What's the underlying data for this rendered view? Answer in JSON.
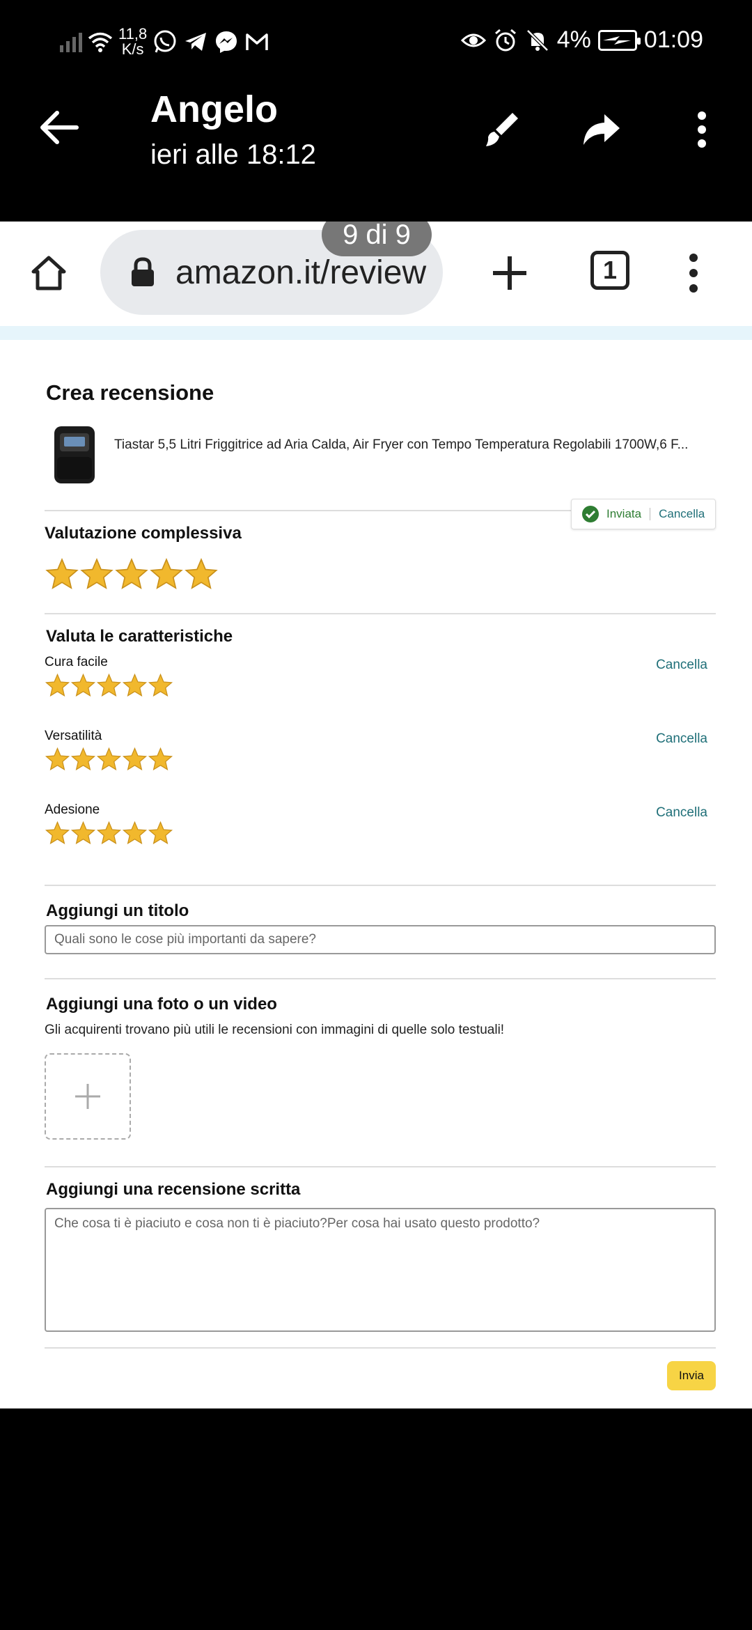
{
  "status_bar": {
    "speed_top": "11,8",
    "speed_bottom": "K/s",
    "battery": "4%",
    "time": "01:09"
  },
  "viewer": {
    "sender": "Angelo",
    "timestamp": "ieri alle 18:12",
    "icons": [
      "back-arrow-icon",
      "brush-icon",
      "forward-icon",
      "more-vert-icon"
    ]
  },
  "browser": {
    "url": "amazon.it/review",
    "tab_count": "1",
    "page_counter": "9 di 9"
  },
  "review": {
    "heading": "Crea recensione",
    "product_title": "Tiastar 5,5 Litri Friggitrice ad Aria Calda, Air Fryer con Tempo Temperatura Regolabili 1700W,6 F...",
    "overall": {
      "label": "Valutazione complessiva",
      "rating": 5,
      "max": 5,
      "status_sent": "Inviata",
      "cancel": "Cancella"
    },
    "features": {
      "label": "Valuta le caratteristiche",
      "items": [
        {
          "name": "Cura facile",
          "rating": 5,
          "cancel": "Cancella"
        },
        {
          "name": "Versatilità",
          "rating": 5,
          "cancel": "Cancella"
        },
        {
          "name": "Adesione",
          "rating": 5,
          "cancel": "Cancella"
        }
      ]
    },
    "title_section": {
      "label": "Aggiungi un titolo",
      "placeholder": "Quali sono le cose più importanti da sapere?"
    },
    "media_section": {
      "label": "Aggiungi una foto o un video",
      "hint": "Gli acquirenti trovano più utili le recensioni con immagini di quelle solo testuali!"
    },
    "text_section": {
      "label": "Aggiungi una recensione scritta",
      "placeholder": "Che cosa ti è piaciuto e cosa non ti è piaciuto?Per cosa hai usato questo prodotto?"
    },
    "submit_label": "Invia"
  },
  "colors": {
    "star": "#f1b82d",
    "link": "#1f6f78",
    "sent_green": "#2e7d32",
    "submit_bg": "#f7d445"
  }
}
